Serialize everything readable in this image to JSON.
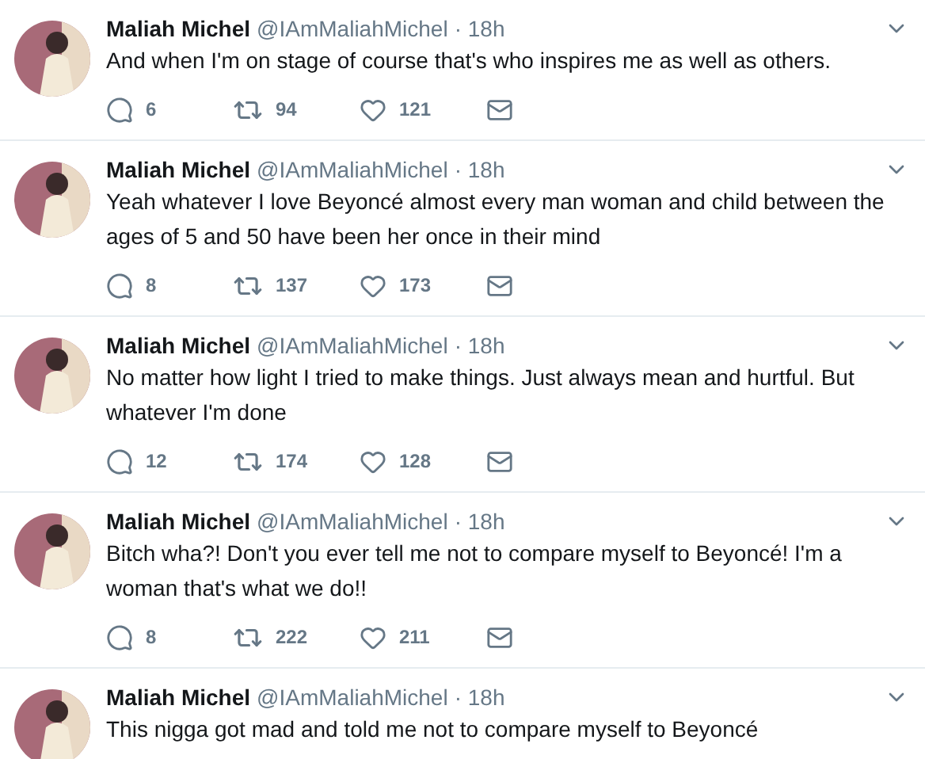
{
  "tweets": [
    {
      "name": "Maliah Michel",
      "handle": "@IAmMaliahMichel",
      "time": "· 18h",
      "text": "And when I'm on stage of course that's who inspires me as well as others.",
      "actions": {
        "replies": "6",
        "retweets": "94",
        "likes": "121"
      }
    },
    {
      "name": "Maliah Michel",
      "handle": "@IAmMaliahMichel",
      "time": "· 18h",
      "text": "Yeah whatever I love Beyoncé almost every man woman and child between the ages of 5 and 50 have been her once in their mind",
      "actions": {
        "replies": "8",
        "retweets": "137",
        "likes": "173"
      }
    },
    {
      "name": "Maliah Michel",
      "handle": "@IAmMaliahMichel",
      "time": "· 18h",
      "text": "No matter how light I tried to make things. Just always mean and hurtful. But whatever I'm done",
      "actions": {
        "replies": "12",
        "retweets": "174",
        "likes": "128"
      }
    },
    {
      "name": "Maliah Michel",
      "handle": "@IAmMaliahMichel",
      "time": "· 18h",
      "text": "Bitch wha?! Don't you ever tell me not to compare myself to Beyoncé! I'm a woman that's what we do!!",
      "actions": {
        "replies": "8",
        "retweets": "222",
        "likes": "211"
      }
    },
    {
      "name": "Maliah Michel",
      "handle": "@IAmMaliahMichel",
      "time": "· 18h",
      "text": "This nigga got mad and told me not to compare myself to Beyoncé"
    }
  ]
}
